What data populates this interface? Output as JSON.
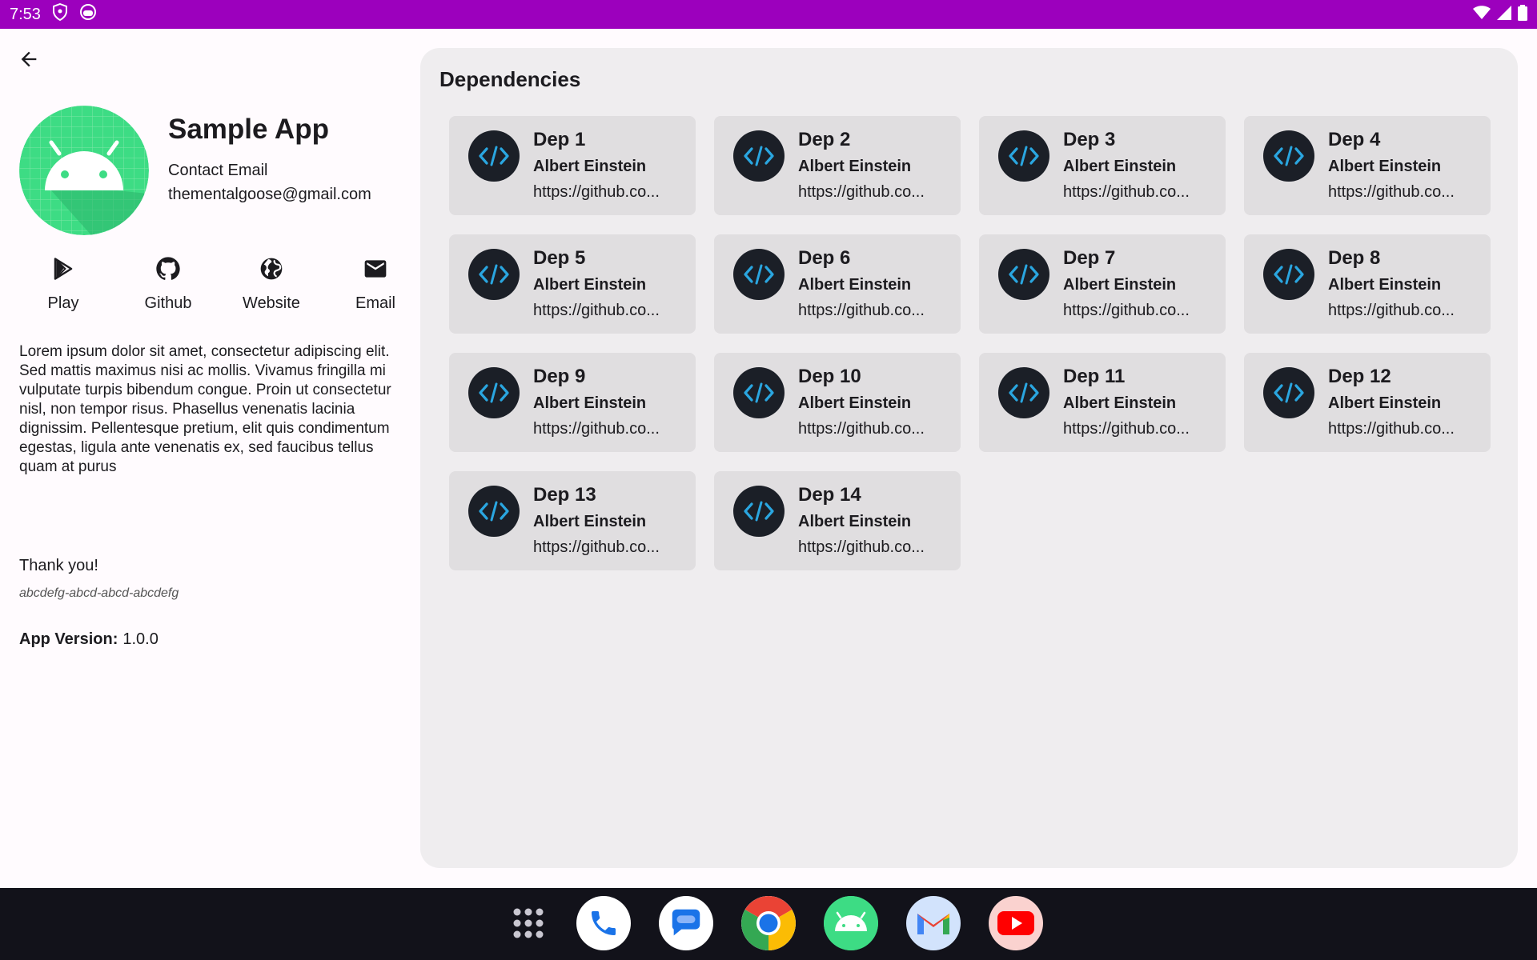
{
  "status_bar": {
    "time": "7:53",
    "left_icons": [
      "shield-icon",
      "face-icon"
    ],
    "right_icons": [
      "wifi-icon",
      "signal-icon",
      "battery-icon"
    ],
    "color": "#9C00BD"
  },
  "header": {
    "back_icon": "arrow-back-icon"
  },
  "app": {
    "name": "Sample App",
    "contact_label": "Contact Email",
    "contact_email": "thementalgoose@gmail.com",
    "icon": "android-icon",
    "icon_color": "#3DDC84"
  },
  "links": [
    {
      "label": "Play",
      "icon": "play-store-icon"
    },
    {
      "label": "Github",
      "icon": "github-icon"
    },
    {
      "label": "Website",
      "icon": "globe-icon"
    },
    {
      "label": "Email",
      "icon": "email-icon"
    }
  ],
  "description": "Lorem ipsum dolor sit amet, consectetur adipiscing elit. Sed mattis maximus nisi ac mollis. Vivamus fringilla mi vulputate turpis bibendum congue. Proin ut consectetur nisl, non tempor risus. Phasellus venenatis lacinia dignissim. Pellentesque pretium, elit quis condimentum egestas, ligula ante venenatis ex, sed faucibus tellus quam at purus",
  "thanks": "Thank you!",
  "install_id": "abcdefg-abcd-abcd-abcdefg",
  "version": {
    "label": "App Version:",
    "value": "1.0.0"
  },
  "dependencies": {
    "title": "Dependencies",
    "icon": "code-icon",
    "items": [
      {
        "name": "Dep 1",
        "author": "Albert Einstein",
        "url": "https://github.co..."
      },
      {
        "name": "Dep 2",
        "author": "Albert Einstein",
        "url": "https://github.co..."
      },
      {
        "name": "Dep 3",
        "author": "Albert Einstein",
        "url": "https://github.co..."
      },
      {
        "name": "Dep 4",
        "author": "Albert Einstein",
        "url": "https://github.co..."
      },
      {
        "name": "Dep 5",
        "author": "Albert Einstein",
        "url": "https://github.co..."
      },
      {
        "name": "Dep 6",
        "author": "Albert Einstein",
        "url": "https://github.co..."
      },
      {
        "name": "Dep 7",
        "author": "Albert Einstein",
        "url": "https://github.co..."
      },
      {
        "name": "Dep 8",
        "author": "Albert Einstein",
        "url": "https://github.co..."
      },
      {
        "name": "Dep 9",
        "author": "Albert Einstein",
        "url": "https://github.co..."
      },
      {
        "name": "Dep 10",
        "author": "Albert Einstein",
        "url": "https://github.co..."
      },
      {
        "name": "Dep 11",
        "author": "Albert Einstein",
        "url": "https://github.co..."
      },
      {
        "name": "Dep 12",
        "author": "Albert Einstein",
        "url": "https://github.co..."
      },
      {
        "name": "Dep 13",
        "author": "Albert Einstein",
        "url": "https://github.co..."
      },
      {
        "name": "Dep 14",
        "author": "Albert Einstein",
        "url": "https://github.co..."
      }
    ]
  },
  "taskbar": {
    "launcher_icon": "app-grid-icon",
    "apps": [
      "phone-icon",
      "messages-icon",
      "chrome-icon",
      "android-app-icon",
      "gmail-icon",
      "youtube-icon"
    ]
  }
}
